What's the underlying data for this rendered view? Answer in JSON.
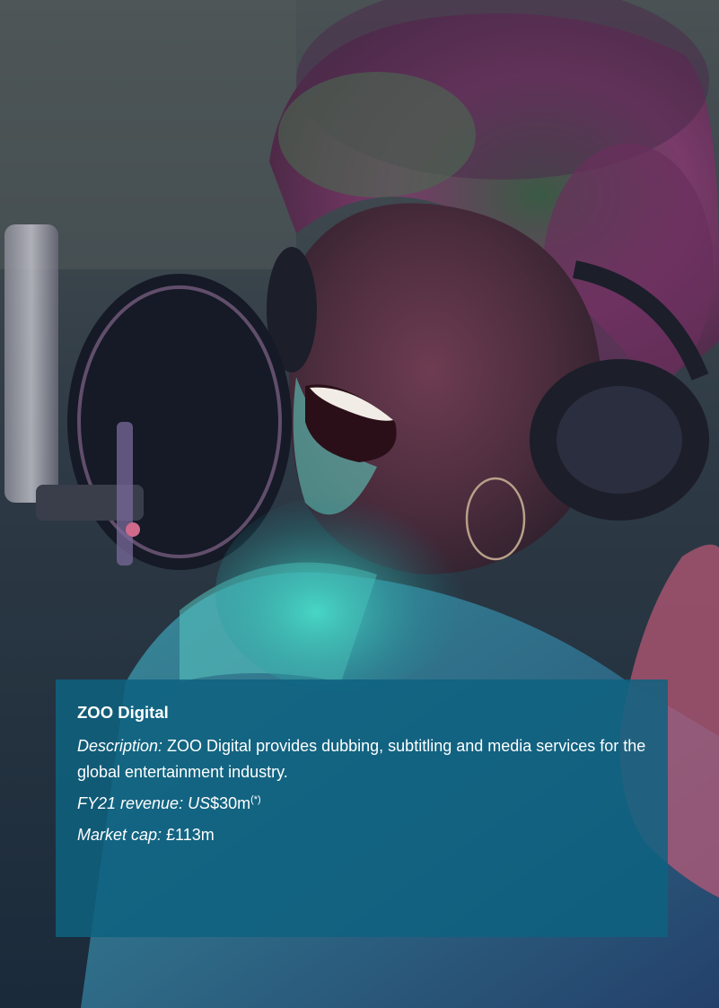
{
  "photo": {
    "subject": "woman singing into studio microphone wearing headphones",
    "colors": {
      "teal_light": "#3fd2c4",
      "magenta_light": "#b0508f",
      "background": "#2b3a44"
    }
  },
  "caption": {
    "title": "ZOO Digital",
    "description_label": "Description:",
    "description_text": " ZOO Digital provides dubbing, subtitling and media services for the global entertainment industry.",
    "revenue_label": "FY21 revenue: US",
    "revenue_value": "$30m",
    "revenue_footnote": "(*)",
    "market_cap_label": "Market cap:",
    "market_cap_value": " £113m",
    "panel_color": "#0e6280"
  }
}
